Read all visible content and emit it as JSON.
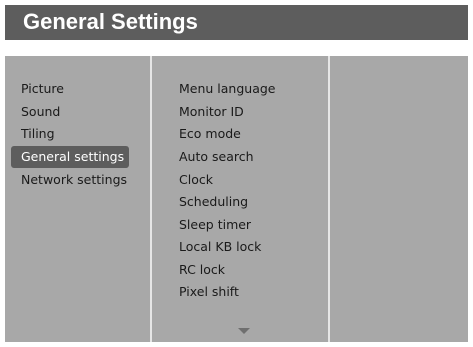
{
  "header": {
    "title": "General Settings"
  },
  "left_menu": {
    "items": [
      {
        "label": "Picture",
        "selected": false
      },
      {
        "label": "Sound",
        "selected": false
      },
      {
        "label": "Tiling",
        "selected": false
      },
      {
        "label": "General settings",
        "selected": true
      },
      {
        "label": "Network settings",
        "selected": false
      }
    ]
  },
  "submenu": {
    "items": [
      {
        "label": "Menu language"
      },
      {
        "label": "Monitor ID"
      },
      {
        "label": "Eco mode"
      },
      {
        "label": "Auto search"
      },
      {
        "label": "Clock"
      },
      {
        "label": "Scheduling"
      },
      {
        "label": "Sleep timer"
      },
      {
        "label": "Local KB lock"
      },
      {
        "label": "RC lock"
      },
      {
        "label": "Pixel shift"
      }
    ],
    "scroll_icon": "chevron-down-icon"
  },
  "colors": {
    "title_bar": "#5d5d5d",
    "panel": "#a8a8a8",
    "selected_item": "#5d5d5d",
    "divider": "#e6e6e6"
  }
}
